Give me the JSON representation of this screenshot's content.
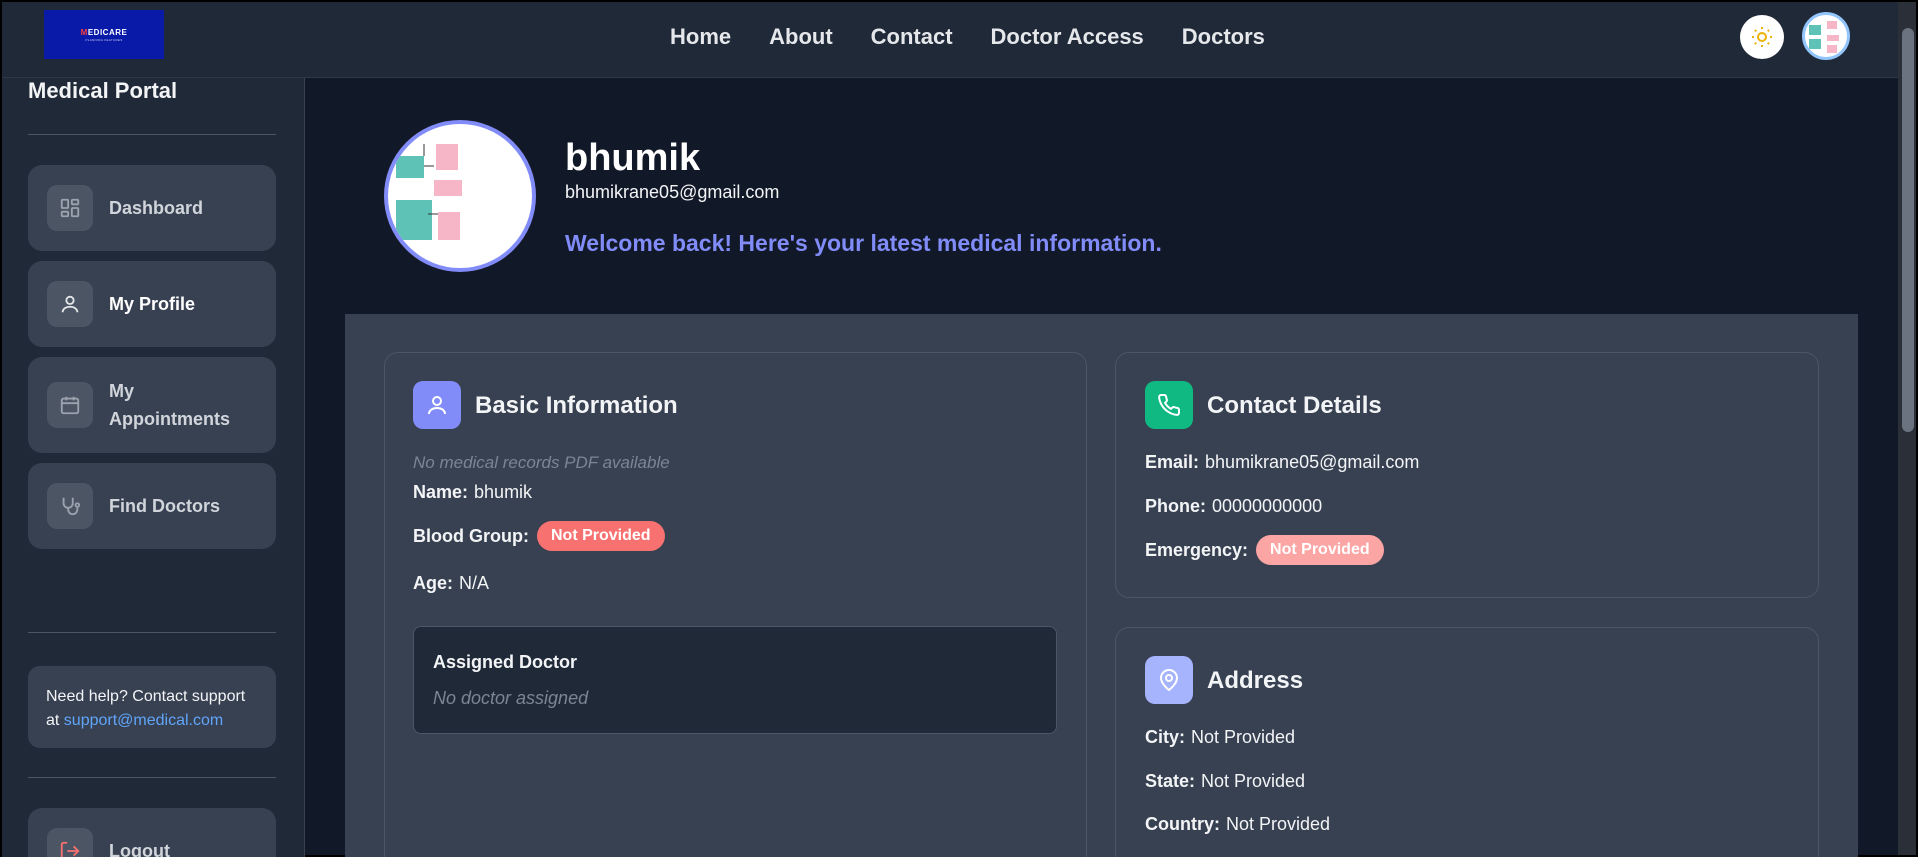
{
  "logo": {
    "text_a": "M",
    "text_b": "EDICARE",
    "sub": "PLANNING FEATURES"
  },
  "nav": {
    "links": [
      "Home",
      "About",
      "Contact",
      "Doctor Access",
      "Doctors"
    ]
  },
  "sidebar": {
    "title": "Medical Portal",
    "items": [
      {
        "label": "Dashboard",
        "icon": "dashboard-icon"
      },
      {
        "label": "My Profile",
        "icon": "user-icon"
      },
      {
        "label": "My Appointments",
        "icon": "calendar-icon"
      },
      {
        "label": "Find Doctors",
        "icon": "stethoscope-icon"
      }
    ],
    "help_text": "Need help? Contact support at ",
    "help_link": "support@medical.com",
    "logout_label": "Logout"
  },
  "profile": {
    "name": "bhumik",
    "email": "bhumikrane05@gmail.com",
    "welcome": "Welcome back! Here's your latest medical information."
  },
  "basic_info": {
    "title": "Basic Information",
    "no_pdf": "No medical records PDF available",
    "name_label": "Name:",
    "name_value": "bhumik",
    "blood_label": "Blood Group:",
    "blood_value": "Not Provided",
    "age_label": "Age:",
    "age_value": "N/A",
    "doctor_title": "Assigned Doctor",
    "doctor_value": "No doctor assigned"
  },
  "contact": {
    "title": "Contact Details",
    "email_label": "Email:",
    "email_value": "bhumikrane05@gmail.com",
    "phone_label": "Phone:",
    "phone_value": "00000000000",
    "emergency_label": "Emergency:",
    "emergency_value": "Not Provided"
  },
  "address": {
    "title": "Address",
    "city_label": "City:",
    "city_value": "Not Provided",
    "state_label": "State:",
    "state_value": "Not Provided",
    "country_label": "Country:",
    "country_value": "Not Provided"
  },
  "colors": {
    "accent": "#818cf8",
    "badge_red": "#f87171",
    "badge_pink": "#fca5a5",
    "contact_green": "#10b981",
    "address_blue": "#a5b4fc",
    "link_blue": "#60a5fa"
  }
}
